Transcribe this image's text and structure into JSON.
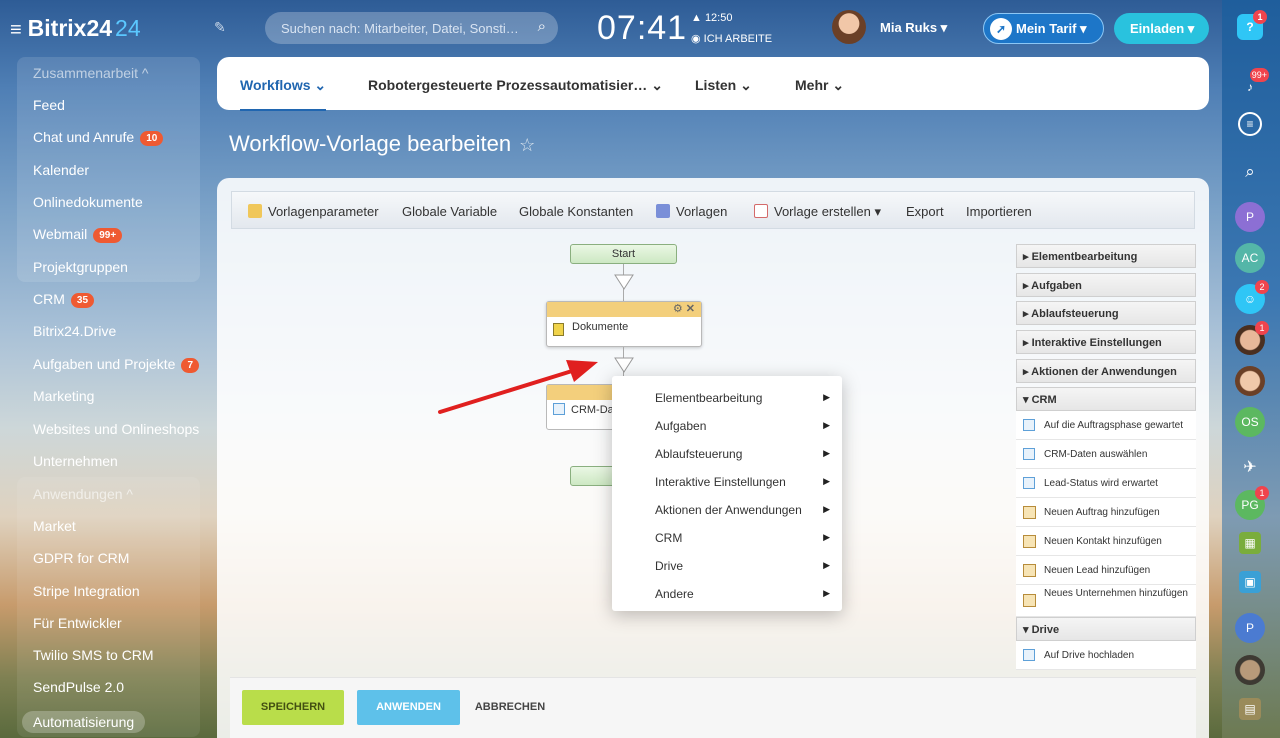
{
  "header": {
    "brand": "Bitrix24",
    "brand_num": "24",
    "search_placeholder": "Suchen nach: Mitarbeiter, Datei, Sonsti…",
    "clock": "07:41",
    "alarm": "▲ 12:50",
    "work_status": "ICH ARBEITE",
    "user_name": "Mia Ruks ▾",
    "tariff_label": "Mein Tarif",
    "invite_label": "Einladen"
  },
  "sidebar": {
    "group1_title": "Zusammenarbeit ^",
    "items": [
      {
        "label": "Feed"
      },
      {
        "label": "Chat und Anrufe",
        "badge": "10"
      },
      {
        "label": "Kalender"
      },
      {
        "label": "Onlinedokumente"
      },
      {
        "label": "Webmail",
        "badge": "99+"
      },
      {
        "label": "Projektgruppen"
      },
      {
        "label": "CRM",
        "badge": "35"
      },
      {
        "label": "Bitrix24.Drive"
      },
      {
        "label": "Aufgaben und Projekte",
        "badge": "7"
      },
      {
        "label": "Marketing"
      },
      {
        "label": "Websites und Onlineshops"
      },
      {
        "label": "Unternehmen"
      }
    ],
    "group2_title": "Anwendungen ^",
    "apps": [
      "Market",
      "GDPR for CRM",
      "Stripe Integration",
      "Für Entwickler",
      "Twilio SMS to CRM",
      "SendPulse 2.0"
    ],
    "automation": "Automatisierung"
  },
  "tabs": [
    "Workflows ⌄",
    "Robotergesteuerte Prozessautomatisier… ⌄",
    "Listen ⌄",
    "Mehr ⌄"
  ],
  "page_title": "Workflow-Vorlage bearbeiten",
  "toolbar": [
    "Vorlagenparameter",
    "Globale Variable",
    "Globale Konstanten",
    "Vorlagen",
    "Vorlage erstellen ▾",
    "Export",
    "Importieren"
  ],
  "workflow": {
    "start": "Start",
    "activity": "Dokumente",
    "crm_node": "CRM-Da"
  },
  "context_menu": [
    "Elementbearbeitung",
    "Aufgaben",
    "Ablaufsteuerung",
    "Interaktive Einstellungen",
    "Aktionen der Anwendungen",
    "CRM",
    "Drive",
    "Andere"
  ],
  "right_panel": {
    "sections": [
      "Elementbearbeitung",
      "Aufgaben",
      "Ablaufsteuerung",
      "Interaktive Einstellungen",
      "Aktionen der Anwendungen"
    ],
    "crm_title": "CRM",
    "crm_items": [
      "Auf die Auftragsphase gewartet",
      "CRM-Daten auswählen",
      "Lead-Status wird erwartet",
      "Neuen Auftrag hinzufügen",
      "Neuen Kontakt hinzufügen",
      "Neuen Lead hinzufügen",
      "Neues Unternehmen hinzufügen"
    ],
    "drive_title": "Drive",
    "drive_items": [
      "Auf Drive hochladen"
    ]
  },
  "buttons": {
    "save": "SPEICHERN",
    "apply": "ANWENDEN",
    "cancel": "ABBRECHEN"
  },
  "rightbar": {
    "help_badge": "1",
    "bell_badge": "99+",
    "p1": "P",
    "ac": "AC",
    "group_badge": "2",
    "face_badge": "1",
    "os": "OS",
    "pg": "PG",
    "pg_badge": "1",
    "p2": "P"
  },
  "colors": {
    "accent": "#2066b0",
    "save": "#b9dd4a",
    "apply": "#5ec1ea",
    "badge": "#ef5a32",
    "arrow": "#e0201f"
  }
}
